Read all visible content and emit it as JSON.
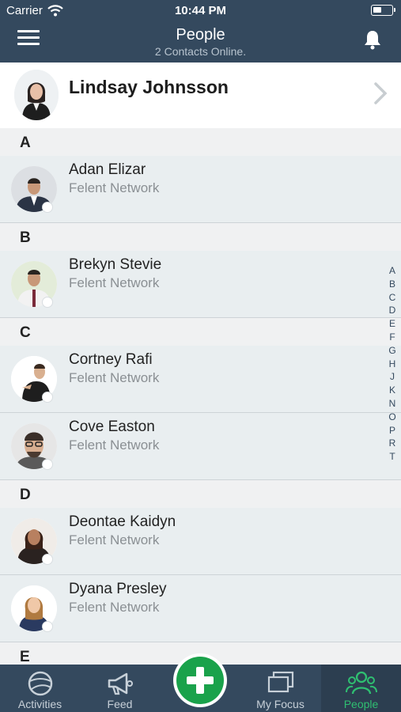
{
  "status_bar": {
    "carrier": "Carrier",
    "time": "10:44 PM"
  },
  "header": {
    "title": "People",
    "subtitle": "2 Contacts Online."
  },
  "me": {
    "name": "Lindsay Johnsson"
  },
  "sections": [
    {
      "letter": "A",
      "contacts": [
        {
          "name": "Adan Elizar",
          "org": "Felent Network"
        }
      ]
    },
    {
      "letter": "B",
      "contacts": [
        {
          "name": "Brekyn Stevie",
          "org": "Felent Network"
        }
      ]
    },
    {
      "letter": "C",
      "contacts": [
        {
          "name": "Cortney Rafi",
          "org": "Felent Network"
        },
        {
          "name": "Cove Easton",
          "org": "Felent Network"
        }
      ]
    },
    {
      "letter": "D",
      "contacts": [
        {
          "name": "Deontae Kaidyn",
          "org": "Felent Network"
        },
        {
          "name": "Dyana Presley",
          "org": "Felent Network"
        }
      ]
    },
    {
      "letter": "E",
      "contacts": []
    }
  ],
  "alphabet_index": [
    "A",
    "B",
    "C",
    "D",
    "E",
    "F",
    "G",
    "H",
    "J",
    "K",
    "N",
    "O",
    "P",
    "R",
    "T"
  ],
  "tabs": [
    {
      "label": "Activities",
      "icon": "activities-icon"
    },
    {
      "label": "Feed",
      "icon": "megaphone-icon"
    },
    {
      "label": "My Focus",
      "icon": "focus-icon"
    },
    {
      "label": "People",
      "icon": "people-icon"
    }
  ],
  "colors": {
    "nav": "#34495e",
    "accent": "#2fbf71",
    "add_button": "#1aa24b"
  }
}
